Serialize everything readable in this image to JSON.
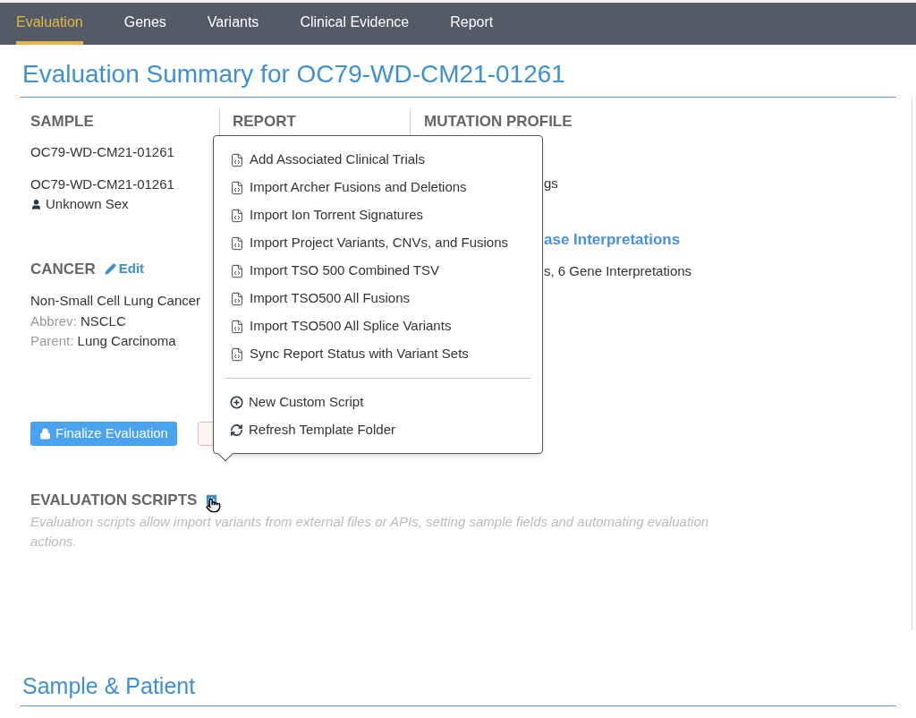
{
  "nav": {
    "tabs": [
      {
        "label": "Evaluation",
        "selected": true
      },
      {
        "label": "Genes",
        "selected": false
      },
      {
        "label": "Variants",
        "selected": false
      },
      {
        "label": "Clinical Evidence",
        "selected": false
      },
      {
        "label": "Report",
        "selected": false
      }
    ]
  },
  "title": "Evaluation Summary for OC79-WD-CM21-01261",
  "sample": {
    "heading": "SAMPLE",
    "sample_id": "OC79-WD-CM21-01261",
    "patient_id": "OC79-WD-CM21-01261",
    "sex": "Unknown Sex"
  },
  "report": {
    "heading": "REPORT"
  },
  "mutation_profile": {
    "heading": "MUTATION PROFILE",
    "line_1": "gs",
    "link": "ase Interpretations",
    "line_2": "s, 6 Gene Interpretations"
  },
  "cancer": {
    "heading": "CANCER",
    "edit": "Edit",
    "name": "Non-Small Cell Lung Cancer",
    "abbrev_label": "Abbrev:",
    "abbrev": "NSCLC",
    "parent_label": "Parent:",
    "parent": "Lung Carcinoma"
  },
  "finalize_button": "Finalize Evaluation",
  "evaluation_scripts": {
    "heading": "EVALUATION SCRIPTS",
    "description": "Evaluation scripts allow import variants from external files or APIs, setting sample fields and automating evaluation actions."
  },
  "menu": {
    "items": [
      {
        "label": "Add Associated Clinical Trials",
        "kind": "script"
      },
      {
        "label": "Import Archer Fusions and Deletions",
        "kind": "script"
      },
      {
        "label": "Import Ion Torrent Signatures",
        "kind": "script"
      },
      {
        "label": "Import Project Variants, CNVs, and Fusions",
        "kind": "script"
      },
      {
        "label": "Import TSO 500 Combined TSV",
        "kind": "script"
      },
      {
        "label": "Import TSO500 All Fusions",
        "kind": "script"
      },
      {
        "label": "Import TSO500 All Splice Variants",
        "kind": "script"
      },
      {
        "label": "Sync Report Status with Variant Sets",
        "kind": "script"
      },
      {
        "label": "New Custom Script",
        "kind": "new"
      },
      {
        "label": "Refresh Template Folder",
        "kind": "refresh"
      }
    ]
  },
  "section_title": "Sample & Patient"
}
